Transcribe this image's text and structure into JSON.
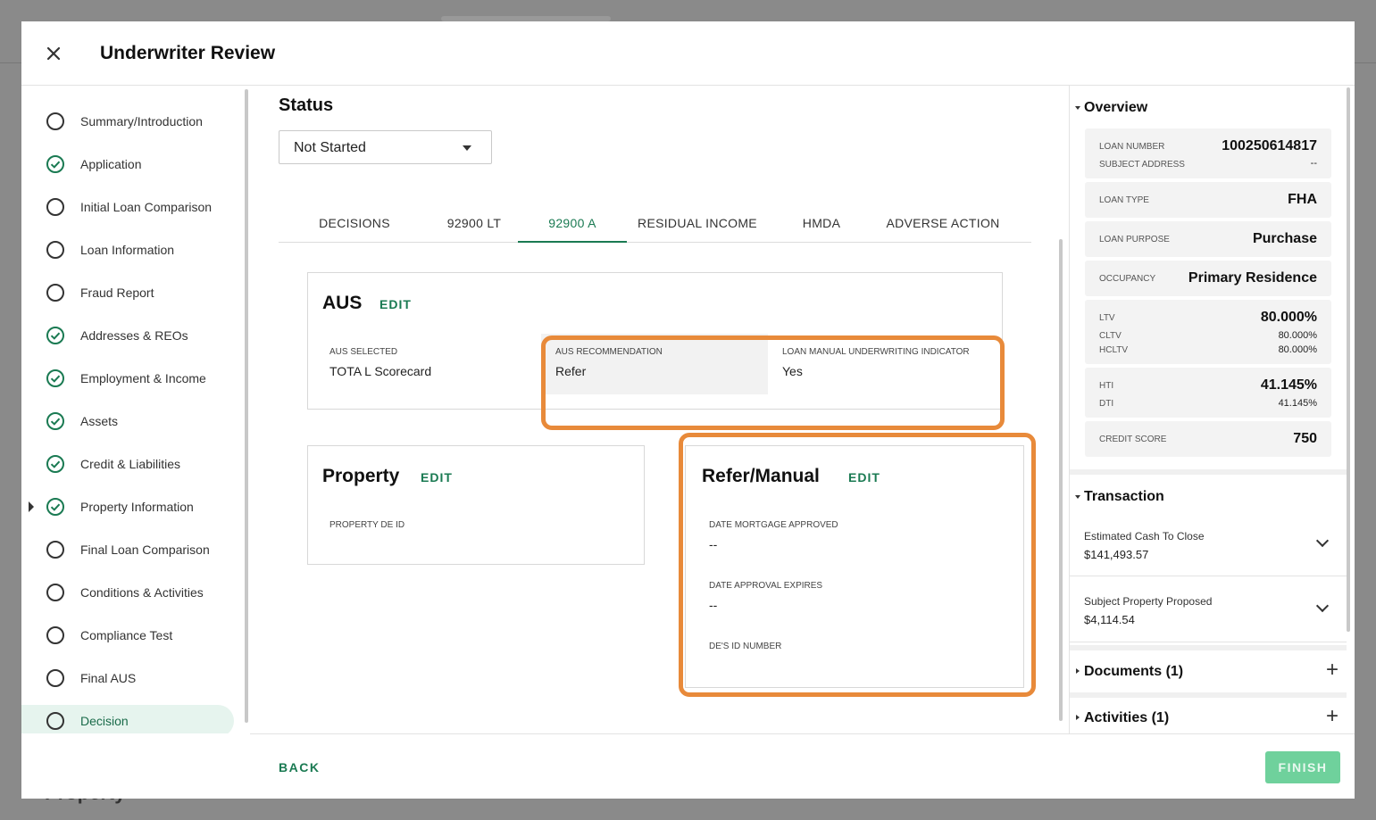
{
  "modal": {
    "title": "Underwriter Review"
  },
  "backdrop": {
    "text": "Property"
  },
  "nav": {
    "items": [
      {
        "label": "Summary/Introduction",
        "status": "incomplete"
      },
      {
        "label": "Application",
        "status": "complete"
      },
      {
        "label": "Initial Loan Comparison",
        "status": "incomplete"
      },
      {
        "label": "Loan Information",
        "status": "incomplete"
      },
      {
        "label": "Fraud Report",
        "status": "incomplete"
      },
      {
        "label": "Addresses & REOs",
        "status": "complete"
      },
      {
        "label": "Employment & Income",
        "status": "complete"
      },
      {
        "label": "Assets",
        "status": "complete"
      },
      {
        "label": "Credit & Liabilities",
        "status": "complete"
      },
      {
        "label": "Property Information",
        "status": "complete",
        "expandable": true
      },
      {
        "label": "Final Loan Comparison",
        "status": "incomplete"
      },
      {
        "label": "Conditions & Activities",
        "status": "incomplete"
      },
      {
        "label": "Compliance Test",
        "status": "incomplete"
      },
      {
        "label": "Final AUS",
        "status": "incomplete"
      },
      {
        "label": "Decision",
        "status": "incomplete",
        "active": true
      }
    ]
  },
  "status": {
    "title": "Status",
    "value": "Not Started"
  },
  "tabs": [
    {
      "label": "DECISIONS"
    },
    {
      "label": "92900 LT"
    },
    {
      "label": "92900 A",
      "active": true
    },
    {
      "label": "RESIDUAL INCOME"
    },
    {
      "label": "HMDA"
    },
    {
      "label": "ADVERSE ACTION"
    }
  ],
  "aus": {
    "title": "AUS",
    "edit": "EDIT",
    "selected_label": "AUS SELECTED",
    "selected_value": "TOTA L Scorecard",
    "recommendation_label": "AUS RECOMMENDATION",
    "recommendation_value": "Refer",
    "manual_label": "LOAN MANUAL UNDERWRITING INDICATOR",
    "manual_value": "Yes"
  },
  "property": {
    "title": "Property",
    "edit": "EDIT",
    "de_id_label": "PROPERTY DE ID"
  },
  "refer": {
    "title": "Refer/Manual",
    "edit": "EDIT",
    "approved_label": "DATE MORTGAGE APPROVED",
    "approved_value": "--",
    "expires_label": "DATE APPROVAL EXPIRES",
    "expires_value": "--",
    "de_number_label": "DE'S ID NUMBER"
  },
  "overview": {
    "title": "Overview",
    "loan_number_label": "LOAN NUMBER",
    "loan_number": "100250614817",
    "subject_address_label": "SUBJECT ADDRESS",
    "subject_address": "--",
    "loan_type_label": "LOAN TYPE",
    "loan_type": "FHA",
    "loan_purpose_label": "LOAN PURPOSE",
    "loan_purpose": "Purchase",
    "occupancy_label": "OCCUPANCY",
    "occupancy": "Primary Residence",
    "ltv_label": "LTV",
    "ltv": "80.000%",
    "cltv_label": "CLTV",
    "cltv": "80.000%",
    "hcltv_label": "HCLTV",
    "hcltv": "80.000%",
    "hti_label": "HTI",
    "hti": "41.145%",
    "dti_label": "DTI",
    "dti": "41.145%",
    "credit_score_label": "CREDIT SCORE",
    "credit_score": "750"
  },
  "transaction": {
    "title": "Transaction",
    "rows": [
      {
        "label": "Estimated Cash To Close",
        "value": "$141,493.57"
      },
      {
        "label": "Subject Property Proposed",
        "value": "$4,114.54"
      }
    ]
  },
  "documents": {
    "title": "Documents (1)"
  },
  "activities": {
    "title": "Activities (1)"
  },
  "footer": {
    "back": "BACK",
    "finish": "FINISH"
  },
  "colors": {
    "accent": "#1a7a52",
    "highlight": "#e88a3a",
    "finish": "#6fd19c",
    "active_nav": "#e6f4ee"
  }
}
